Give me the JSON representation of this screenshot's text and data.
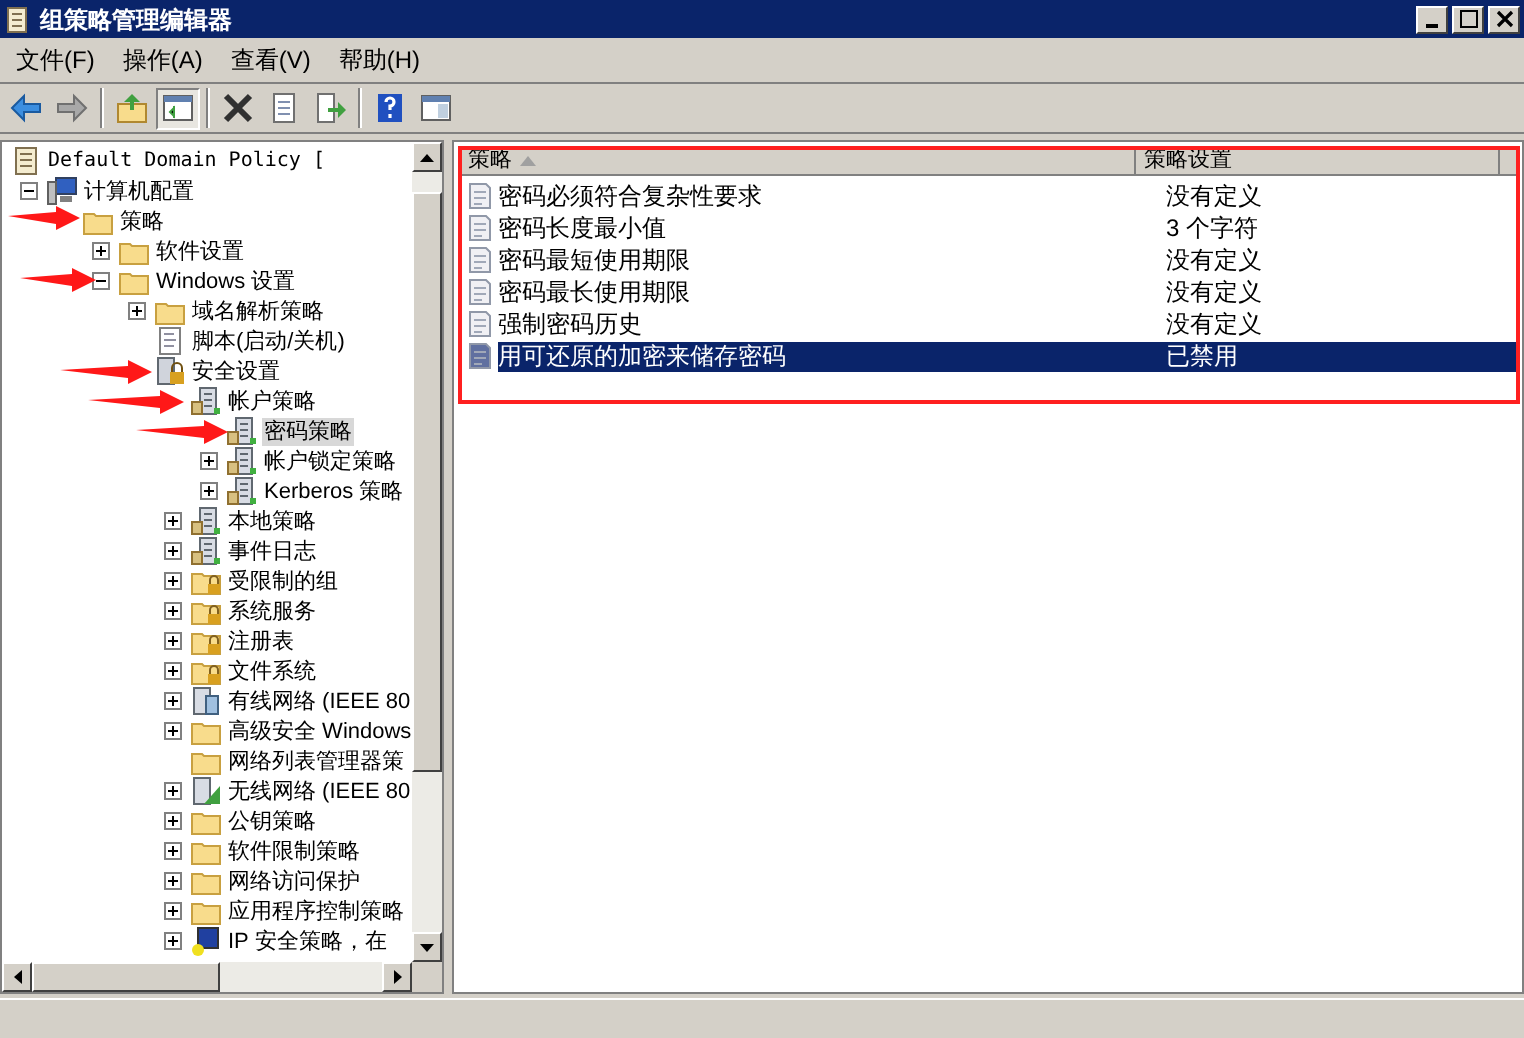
{
  "window": {
    "title": "组策略管理编辑器"
  },
  "menu": [
    "文件(F)",
    "操作(A)",
    "查看(V)",
    "帮助(H)"
  ],
  "toolbar": [
    {
      "kind": "back",
      "pressed": false
    },
    {
      "kind": "forward",
      "pressed": false
    },
    {
      "kind": "sep"
    },
    {
      "kind": "up",
      "pressed": false
    },
    {
      "kind": "tree",
      "pressed": true
    },
    {
      "kind": "sep"
    },
    {
      "kind": "delete",
      "pressed": false
    },
    {
      "kind": "properties",
      "pressed": false
    },
    {
      "kind": "export",
      "pressed": false
    },
    {
      "kind": "sep"
    },
    {
      "kind": "help",
      "pressed": false
    },
    {
      "kind": "pane",
      "pressed": false
    }
  ],
  "tree": [
    {
      "label": "Default Domain Policy [",
      "kind": "scroll",
      "expandable": false,
      "selected": false,
      "children": [
        {
          "label": "计算机配置",
          "kind": "computer",
          "expandable": true,
          "expanded": true,
          "selected": false,
          "children": [
            {
              "label": "策略",
              "kind": "folder",
              "expandable": false,
              "expanded": true,
              "selected": false,
              "children": [
                {
                  "label": "软件设置",
                  "kind": "folder",
                  "expandable": true,
                  "expanded": false,
                  "selected": false
                },
                {
                  "label": "Windows 设置",
                  "kind": "folder",
                  "expandable": true,
                  "expanded": true,
                  "selected": false,
                  "children": [
                    {
                      "label": "域名解析策略",
                      "kind": "folder",
                      "expandable": true,
                      "expanded": false,
                      "selected": false
                    },
                    {
                      "label": "脚本(启动/关机)",
                      "kind": "script",
                      "expandable": false,
                      "selected": false
                    },
                    {
                      "label": "安全设置",
                      "kind": "secure",
                      "expandable": false,
                      "expanded": true,
                      "selected": false,
                      "children": [
                        {
                          "label": "帐户策略",
                          "kind": "policy",
                          "expandable": false,
                          "expanded": true,
                          "selected": false,
                          "children": [
                            {
                              "label": "密码策略",
                              "kind": "policy",
                              "expandable": false,
                              "selected": true
                            },
                            {
                              "label": "帐户锁定策略",
                              "kind": "policy",
                              "expandable": true,
                              "expanded": false,
                              "selected": false
                            },
                            {
                              "label": "Kerberos 策略",
                              "kind": "policy",
                              "expandable": true,
                              "expanded": false,
                              "selected": false
                            }
                          ]
                        },
                        {
                          "label": "本地策略",
                          "kind": "policy",
                          "expandable": true,
                          "expanded": false,
                          "selected": false
                        },
                        {
                          "label": "事件日志",
                          "kind": "policy",
                          "expandable": true,
                          "expanded": false,
                          "selected": false
                        },
                        {
                          "label": "受限制的组",
                          "kind": "lockfolder",
                          "expandable": true,
                          "expanded": false,
                          "selected": false
                        },
                        {
                          "label": "系统服务",
                          "kind": "lockfolder",
                          "expandable": true,
                          "expanded": false,
                          "selected": false
                        },
                        {
                          "label": "注册表",
                          "kind": "lockfolder",
                          "expandable": true,
                          "expanded": false,
                          "selected": false
                        },
                        {
                          "label": "文件系统",
                          "kind": "lockfolder",
                          "expandable": true,
                          "expanded": false,
                          "selected": false
                        },
                        {
                          "label": "有线网络 (IEEE 80",
                          "kind": "network",
                          "expandable": true,
                          "expanded": false,
                          "selected": false
                        },
                        {
                          "label": "高级安全 Windows",
                          "kind": "folder",
                          "expandable": true,
                          "expanded": false,
                          "selected": false
                        },
                        {
                          "label": "网络列表管理器策",
                          "kind": "folder",
                          "expandable": false,
                          "selected": false
                        },
                        {
                          "label": "无线网络 (IEEE 80",
                          "kind": "wireless",
                          "expandable": true,
                          "expanded": false,
                          "selected": false
                        },
                        {
                          "label": "公钥策略",
                          "kind": "folder",
                          "expandable": true,
                          "expanded": false,
                          "selected": false
                        },
                        {
                          "label": "软件限制策略",
                          "kind": "folder",
                          "expandable": true,
                          "expanded": false,
                          "selected": false
                        },
                        {
                          "label": "网络访问保护",
                          "kind": "folder",
                          "expandable": true,
                          "expanded": false,
                          "selected": false
                        },
                        {
                          "label": "应用程序控制策略",
                          "kind": "folder",
                          "expandable": true,
                          "expanded": false,
                          "selected": false
                        },
                        {
                          "label": "IP 安全策略，在",
                          "kind": "ip",
                          "expandable": true,
                          "expanded": false,
                          "selected": false
                        }
                      ]
                    }
                  ]
                }
              ]
            }
          ]
        }
      ]
    }
  ],
  "table": {
    "columns": [
      "策略",
      "策略设置"
    ],
    "rows": [
      {
        "policy": "密码必须符合复杂性要求",
        "setting": "没有定义",
        "selected": false
      },
      {
        "policy": "密码长度最小值",
        "setting": "3 个字符",
        "selected": false
      },
      {
        "policy": "密码最短使用期限",
        "setting": "没有定义",
        "selected": false
      },
      {
        "policy": "密码最长使用期限",
        "setting": "没有定义",
        "selected": false
      },
      {
        "policy": "强制密码历史",
        "setting": "没有定义",
        "selected": false
      },
      {
        "policy": "用可还原的加密来储存密码",
        "setting": "已禁用",
        "selected": true
      }
    ]
  }
}
